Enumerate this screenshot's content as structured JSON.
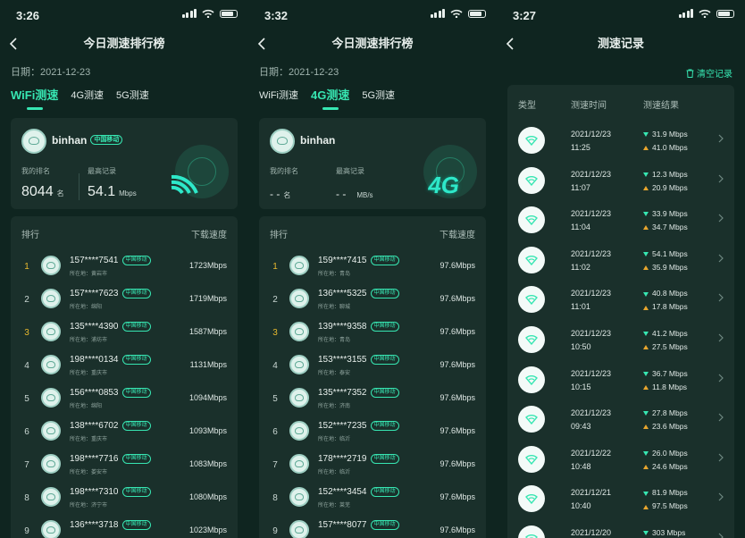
{
  "colors": {
    "background": "#0f2520",
    "card": "#1a302b",
    "accent": "#37e6b2",
    "gold": "#e8b92e",
    "upload": "#e8a62e"
  },
  "icons": [
    "back-icon",
    "wifi-icon",
    "signal-icon",
    "battery-icon",
    "trash-icon",
    "chevron-right-icon",
    "wifi-badge-icon"
  ],
  "panel1": {
    "time": "3:26",
    "title": "今日测速排行榜",
    "date": "日期：2021-12-23",
    "tabs": [
      "WiFi测速",
      "4G测速",
      "5G测速"
    ],
    "me": {
      "name": "binhan",
      "operator": "中国移动",
      "rank_label": "我的排名",
      "best_label": "最高记录",
      "rank_value": "8044",
      "rank_unit": "名",
      "best_value": "54.1",
      "best_unit": "Mbps"
    },
    "list_header": {
      "rank": "排行",
      "speed": "下载速度"
    },
    "rows": [
      {
        "rank": "1",
        "phone": "157****7541",
        "operator": "中国移动",
        "loc": "所在地：黄岩市",
        "speed": "1723Mbps"
      },
      {
        "rank": "2",
        "phone": "157****7623",
        "operator": "中国移动",
        "loc": "所在地：绵阳",
        "speed": "1719Mbps"
      },
      {
        "rank": "3",
        "phone": "135****4390",
        "operator": "中国移动",
        "loc": "所在地：浦坊市",
        "speed": "1587Mbps"
      },
      {
        "rank": "4",
        "phone": "198****0134",
        "operator": "中国移动",
        "loc": "所在地：重庆市",
        "speed": "1131Mbps"
      },
      {
        "rank": "5",
        "phone": "156****0853",
        "operator": "中国移动",
        "loc": "所在地：绵阳",
        "speed": "1094Mbps"
      },
      {
        "rank": "6",
        "phone": "138****6702",
        "operator": "中国移动",
        "loc": "所在地：重庆市",
        "speed": "1093Mbps"
      },
      {
        "rank": "7",
        "phone": "198****7716",
        "operator": "中国移动",
        "loc": "所在地：娄安市",
        "speed": "1083Mbps"
      },
      {
        "rank": "8",
        "phone": "198****7310",
        "operator": "中国移动",
        "loc": "所在地：济宁市",
        "speed": "1080Mbps"
      },
      {
        "rank": "9",
        "phone": "136****3718",
        "operator": "中国移动",
        "loc": "",
        "speed": "1023Mbps"
      }
    ]
  },
  "panel2": {
    "time": "3:32",
    "title": "今日测速排行榜",
    "date": "日期：2021-12-23",
    "tabs": [
      "WiFi测速",
      "4G测速",
      "5G测速"
    ],
    "me": {
      "name": "binhan",
      "rank_label": "我的排名",
      "best_label": "最高记录",
      "rank_value": "- -",
      "rank_unit": "名",
      "best_value": "- -",
      "best_unit": "MB/s",
      "badge": "4G"
    },
    "list_header": {
      "rank": "排行",
      "speed": "下载速度"
    },
    "rows": [
      {
        "rank": "1",
        "phone": "159****7415",
        "operator": "中国移动",
        "loc": "所在地：青岛",
        "speed": "97.6Mbps"
      },
      {
        "rank": "2",
        "phone": "136****5325",
        "operator": "中国移动",
        "loc": "所在地：聊城",
        "speed": "97.6Mbps"
      },
      {
        "rank": "3",
        "phone": "139****9358",
        "operator": "中国移动",
        "loc": "所在地：青岛",
        "speed": "97.6Mbps"
      },
      {
        "rank": "4",
        "phone": "153****3155",
        "operator": "中国移动",
        "loc": "所在地：泰安",
        "speed": "97.6Mbps"
      },
      {
        "rank": "5",
        "phone": "135****7352",
        "operator": "中国移动",
        "loc": "所在地：济南",
        "speed": "97.6Mbps"
      },
      {
        "rank": "6",
        "phone": "152****7235",
        "operator": "中国移动",
        "loc": "所在地：临沂",
        "speed": "97.6Mbps"
      },
      {
        "rank": "7",
        "phone": "178****2719",
        "operator": "中国移动",
        "loc": "所在地：临沂",
        "speed": "97.6Mbps"
      },
      {
        "rank": "8",
        "phone": "152****3454",
        "operator": "中国移动",
        "loc": "所在地：莱芜",
        "speed": "97.6Mbps"
      },
      {
        "rank": "9",
        "phone": "157****8077",
        "operator": "中国移动",
        "loc": "",
        "speed": "97.6Mbps"
      }
    ]
  },
  "panel3": {
    "time": "3:27",
    "title": "测速记录",
    "clear": "清空记录",
    "headers": {
      "type": "类型",
      "time": "测速时间",
      "result": "测速结果"
    },
    "records": [
      {
        "date": "2021/12/23",
        "time": "11:25",
        "down": "31.9 Mbps",
        "up": "41.0 Mbps"
      },
      {
        "date": "2021/12/23",
        "time": "11:07",
        "down": "12.3 Mbps",
        "up": "20.9 Mbps"
      },
      {
        "date": "2021/12/23",
        "time": "11:04",
        "down": "33.9 Mbps",
        "up": "34.7 Mbps"
      },
      {
        "date": "2021/12/23",
        "time": "11:02",
        "down": "54.1 Mbps",
        "up": "35.9 Mbps"
      },
      {
        "date": "2021/12/23",
        "time": "11:01",
        "down": "40.8 Mbps",
        "up": "17.8 Mbps"
      },
      {
        "date": "2021/12/23",
        "time": "10:50",
        "down": "41.2 Mbps",
        "up": "27.5 Mbps"
      },
      {
        "date": "2021/12/23",
        "time": "10:15",
        "down": "36.7 Mbps",
        "up": "11.8 Mbps"
      },
      {
        "date": "2021/12/23",
        "time": "09:43",
        "down": "27.8 Mbps",
        "up": "23.6 Mbps"
      },
      {
        "date": "2021/12/22",
        "time": "10:48",
        "down": "26.0 Mbps",
        "up": "24.6 Mbps"
      },
      {
        "date": "2021/12/21",
        "time": "10:40",
        "down": "81.9 Mbps",
        "up": "97.5 Mbps"
      },
      {
        "date": "2021/12/20",
        "time": "",
        "down": "303 Mbps",
        "up": ""
      }
    ]
  }
}
